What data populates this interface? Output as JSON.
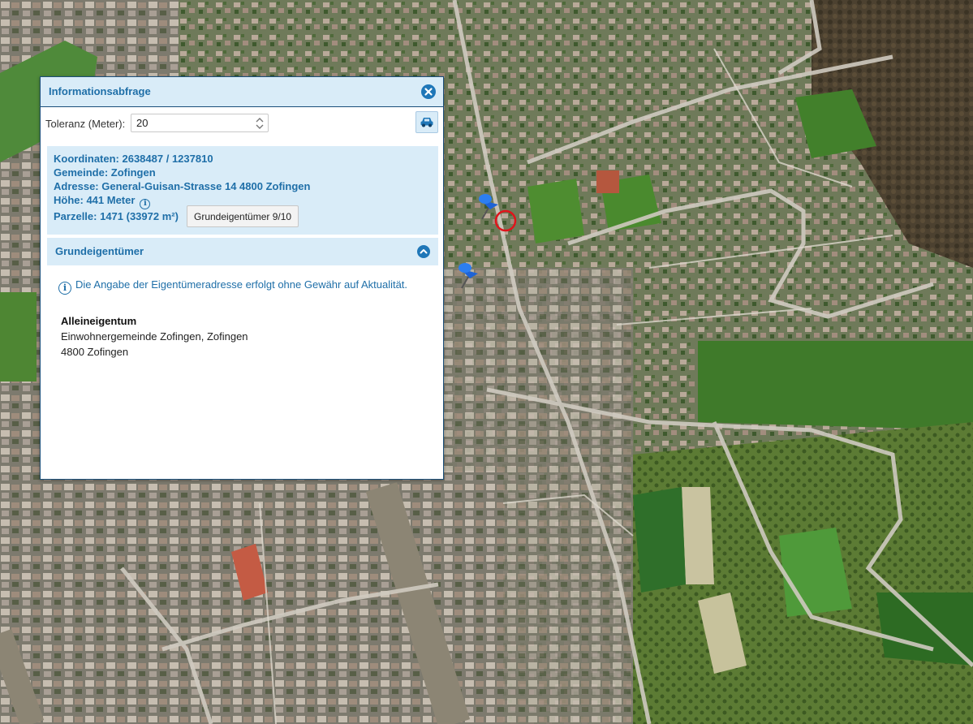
{
  "map": {
    "description_icons": [
      "map-pin-icon",
      "map-pin-icon",
      "query-point-marker-icon"
    ]
  },
  "panel": {
    "title": "Informationsabfrage",
    "close_icon": "close-icon",
    "tolerance": {
      "label": "Toleranz (Meter):",
      "value": "20"
    },
    "car_icon": "car-icon",
    "info": {
      "koordinaten": "Koordinaten: 2638487 / 1237810",
      "gemeinde": "Gemeinde: Zofingen",
      "adresse": "Adresse: General-Guisan-Strasse 14 4800 Zofingen",
      "hoehe": "Höhe: 441 Meter",
      "parzelle": "Parzelle: 1471 (33972 m²)",
      "owner_button": "Grundeigentümer 9/10"
    },
    "owners": {
      "title": "Grundeigentümer",
      "notice": "Die Angabe der Eigentümeradresse erfolgt ohne Gewähr auf Aktualität.",
      "type": "Alleineigentum",
      "name": "Einwohnergemeinde Zofingen, Zofingen",
      "address": "4800 Zofingen"
    }
  },
  "colors": {
    "accent": "#1f77b8",
    "panel_header_bg": "#d9ecf8",
    "text_accent": "#1f6fa8"
  }
}
